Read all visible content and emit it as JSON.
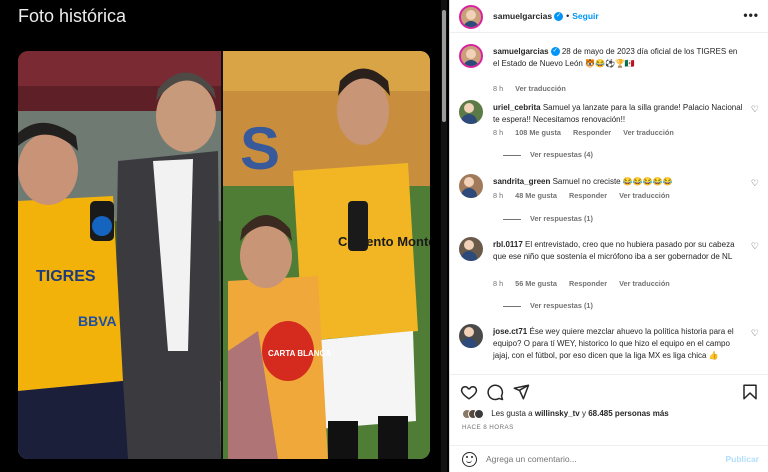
{
  "media": {
    "title": "Foto histórica",
    "overlay_text": {
      "shirt_left_brand": "TIGRES",
      "shirt_left_sponsor": "BBVA",
      "shirt_boy_sponsor": "CARTA BLANCA",
      "shirt_right_text": "Cemento Monterrey",
      "stand_letter": "S"
    }
  },
  "header": {
    "username": "samuelgarcias",
    "verified_glyph": "✓",
    "separator": "•",
    "follow_label": "Seguir",
    "more_label": "•••"
  },
  "caption": {
    "username": "samuelgarcias",
    "verified_glyph": "✓",
    "text": "28 de mayo de 2023 día oficial de los TIGRES en el Estado de Nuevo León 🐯😂⚽🏆🇲🇽",
    "time": "8 h",
    "translate": "Ver traducción"
  },
  "comments": [
    {
      "username": "uriel_cebrita",
      "text": "Samuel ya lanzate para la silla grande! Palacio Nacional te espera!! Necesitamos renovación!!",
      "time": "8 h",
      "likes": "108 Me gusta",
      "reply": "Responder",
      "translate": "Ver traducción",
      "replies": "Ver respuestas (4)"
    },
    {
      "username": "sandrita_green",
      "text": "Samuel no creciste 😂😂😂😂😂",
      "time": "8 h",
      "likes": "48 Me gusta",
      "reply": "Responder",
      "translate": "Ver traducción",
      "replies": "Ver respuestas (1)"
    },
    {
      "username": "rbl.0117",
      "text": "El entrevistado, creo que no hubiera pasado por su cabeza que ese niño que sostenía el micrófono iba a ser gobernador de NL",
      "time": "8 h",
      "likes": "56 Me gusta",
      "reply": "Responder",
      "translate": "Ver traducción",
      "replies": "Ver respuestas (1)"
    },
    {
      "username": "jose.ct71",
      "text": "Ése wey quiere mezclar ahuevo la política historia para el equipo? O para tí WEY, historico lo que hizo el equipo en el campo jajaj, con el fútbol, por eso dicen que la liga MX es liga chica 👍",
      "time": "",
      "likes": "",
      "reply": "",
      "translate": "",
      "replies": ""
    }
  ],
  "actions": {
    "icons": [
      "heart-icon",
      "comment-icon",
      "share-icon",
      "bookmark-icon"
    ],
    "likes_prefix": "Les gusta a",
    "likes_user": "willinsky_tv",
    "likes_conj": "y",
    "likes_count": "68.485 personas más",
    "timestamp": "HACE 8 HORAS"
  },
  "add_comment": {
    "placeholder": "Agrega un comentario...",
    "publish_label": "Publicar",
    "emoji_icon": "emoji-icon"
  },
  "colors": {
    "accent": "#0095f6",
    "publish_disabled": "#b2dffc",
    "tigres_yellow": "#f5b800",
    "meta_gray": "#737373"
  }
}
